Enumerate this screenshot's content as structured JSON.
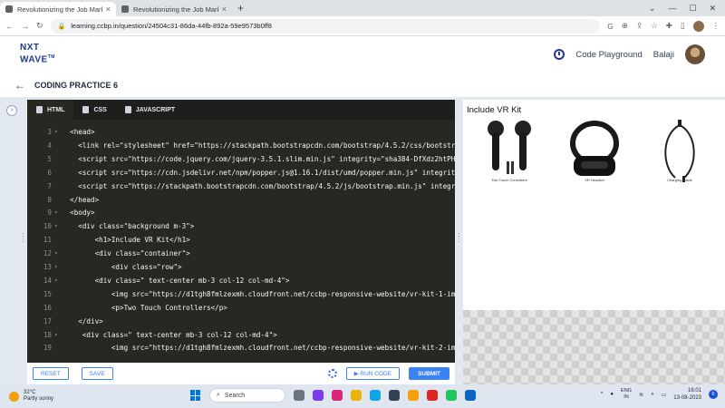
{
  "browser": {
    "tabs": [
      {
        "title": "Revolutionizing the Job Market |",
        "active": true
      },
      {
        "title": "Revolutionizing the Job Market |",
        "active": false
      }
    ],
    "url": "learning.ccbp.in/question/24504c31-86da-44fb-892a-59e9573b0ff8"
  },
  "header": {
    "logo_line1": "NXT",
    "logo_line2": "WAVE",
    "logo_tm": "TM",
    "code_playground": "Code Playground",
    "user_name": "Balaji"
  },
  "practice": {
    "title": "CODING PRACTICE 6"
  },
  "editor": {
    "tabs": [
      {
        "label": "HTML",
        "active": true
      },
      {
        "label": "CSS",
        "active": false
      },
      {
        "label": "JAVASCRIPT",
        "active": false
      }
    ],
    "lines": [
      {
        "n": "3",
        "fold": "▾",
        "text": "  <head>"
      },
      {
        "n": "4",
        "fold": "",
        "text": "    <link rel=\"stylesheet\" href=\"https://stackpath.bootstrapcdn.com/bootstrap/4.5.2/css/bootstr"
      },
      {
        "n": "5",
        "fold": "",
        "text": "    <script src=\"https://code.jquery.com/jquery-3.5.1.slim.min.js\" integrity=\"sha384-DfXdz2htPH"
      },
      {
        "n": "6",
        "fold": "",
        "text": "    <script src=\"https://cdn.jsdelivr.net/npm/popper.js@1.16.1/dist/umd/popper.min.js\" integrit"
      },
      {
        "n": "7",
        "fold": "",
        "text": "    <script src=\"https://stackpath.bootstrapcdn.com/bootstrap/4.5.2/js/bootstrap.min.js\" integr"
      },
      {
        "n": "8",
        "fold": "",
        "text": "  </head>"
      },
      {
        "n": "9",
        "fold": "▾",
        "text": "  <body>"
      },
      {
        "n": "10",
        "fold": "▾",
        "text": "    <div class=\"background m-3\">"
      },
      {
        "n": "11",
        "fold": "",
        "text": "        <h1>Include VR Kit</h1>"
      },
      {
        "n": "12",
        "fold": "▾",
        "text": "        <div class=\"container\">"
      },
      {
        "n": "13",
        "fold": "▾",
        "text": "            <div class=\"row\">"
      },
      {
        "n": "14",
        "fold": "▾",
        "text": "        <div class=\" text-center mb-3 col-12 col-md-4\">"
      },
      {
        "n": "15",
        "fold": "",
        "text": "            <img src=\"https://d1tgh8fmlzexmh.cloudfront.net/ccbp-responsive-website/vr-kit-1-im"
      },
      {
        "n": "16",
        "fold": "",
        "text": "            <p>Two Touch Controllers</p>"
      },
      {
        "n": "17",
        "fold": "",
        "text": "    </div>"
      },
      {
        "n": "18",
        "fold": "▾",
        "text": "     <div class=\" text-center mb-3 col-12 col-md-4\">"
      },
      {
        "n": "19",
        "fold": "",
        "text": "            <img src=\"https://d1tgh8fmlzexmh.cloudfront.net/ccbp-responsive-website/vr-kit-2-im"
      }
    ],
    "reset_label": "RESET",
    "save_label": "SAVE",
    "run_label": "▶ RUN CODE",
    "submit_label": "SUBMIT"
  },
  "preview": {
    "title": "Include VR Kit",
    "items": [
      {
        "caption": "Two Touch Controllers"
      },
      {
        "caption": "VR Headset"
      },
      {
        "caption": "Charging Cable"
      }
    ]
  },
  "taskbar": {
    "temperature": "32°C",
    "weather": "Partly sunny",
    "search_placeholder": "Search",
    "lang_line1": "ENG",
    "lang_line2": "IN",
    "time": "16:01",
    "date": "13-08-2023",
    "notif_count": "6"
  },
  "colors": {
    "accent": "#3b82f6",
    "brand": "#1e3a8a",
    "editor_bg": "#272822"
  }
}
